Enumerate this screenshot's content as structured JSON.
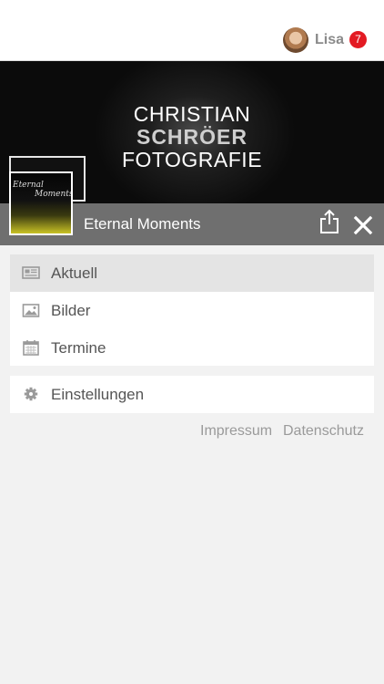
{
  "header": {
    "user_name": "Lisa",
    "notification_count": "7"
  },
  "cover": {
    "brand_lines": [
      "CHRISTIAN",
      "SCHRÖER",
      "FOTOGRAFIE"
    ]
  },
  "logo": {
    "lines": [
      "Eternal",
      "Moments"
    ]
  },
  "titlebar": {
    "title": "Eternal Moments",
    "share_icon": "share-icon",
    "close_icon": "close-icon"
  },
  "menu": {
    "items": [
      {
        "label": "Aktuell",
        "icon": "newspaper-icon",
        "active": true
      },
      {
        "label": "Bilder",
        "icon": "image-icon",
        "active": false
      },
      {
        "label": "Termine",
        "icon": "calendar-icon",
        "active": false
      }
    ],
    "settings": {
      "label": "Einstellungen",
      "icon": "gear-icon"
    }
  },
  "footer_links": {
    "impressum": "Impressum",
    "datenschutz": "Datenschutz"
  },
  "colors": {
    "badge": "#e31b23",
    "titlebar": "#6f6f6f",
    "accent_logo": "#c9c224"
  }
}
